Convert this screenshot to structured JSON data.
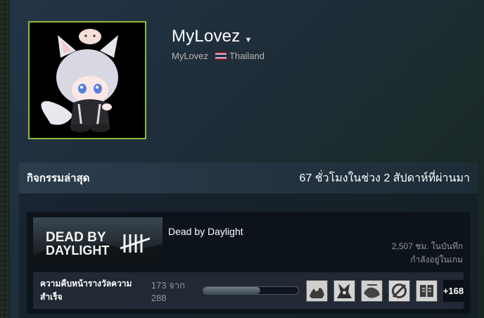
{
  "profile": {
    "persona_name": "MyLovez",
    "account_name": "MyLovez",
    "country": "Thailand",
    "accent_color": "#90ba3c"
  },
  "activity": {
    "title": "กิจกรรมล่าสุด",
    "hours_summary": "67 ชั่วโมงในช่วง 2 สัปดาห์ที่ผ่านมา"
  },
  "game": {
    "name": "Dead by Daylight",
    "capsule_text_line1": "DEAD BY",
    "capsule_text_line2": "DAYLIGHT",
    "hours_on_record": "2,507 ชม. ในบันทึก",
    "status": "กำลังอยู่ในเกม"
  },
  "achievements": {
    "label": "ความคืบหน้ารางวัลความสำเร็จ",
    "count_text": "173 จาก 288",
    "progress_fraction": 0.6,
    "more_label": "+168",
    "icons": [
      "achievement-icon-1",
      "achievement-icon-2",
      "achievement-icon-3",
      "achievement-icon-4",
      "achievement-icon-5"
    ]
  }
}
